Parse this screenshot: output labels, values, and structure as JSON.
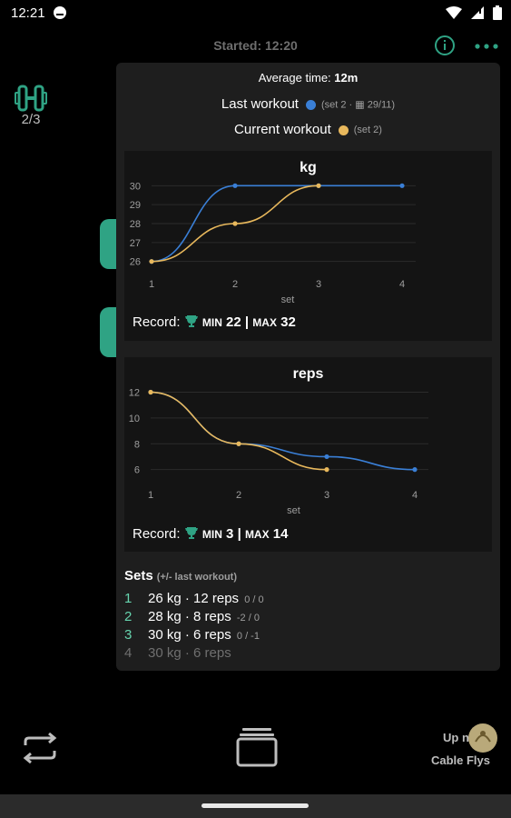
{
  "status": {
    "time": "12:21"
  },
  "header": {
    "started": "Started: 12:20"
  },
  "exercise": {
    "count": "2/3"
  },
  "panel": {
    "avg_label": "Average time:",
    "avg_value": "12m",
    "legend": {
      "last_label": "Last workout",
      "last_sub": "(set 2 · ▦ 29/11)",
      "current_label": "Current workout",
      "current_sub": "(set 2)"
    },
    "colors": {
      "last": "#3a7fd6",
      "current": "#e8b85c",
      "accent": "#2fa384"
    }
  },
  "chart_data": [
    {
      "type": "line",
      "title": "kg",
      "xlabel": "set",
      "x_ticks": [
        "1",
        "2",
        "3",
        "4"
      ],
      "y_ticks": [
        "26",
        "27",
        "28",
        "29",
        "30"
      ],
      "ylim": [
        25.6,
        30.4
      ],
      "series": [
        {
          "name": "Last workout",
          "x": [
            1,
            2,
            3,
            4
          ],
          "values": [
            26,
            30,
            30,
            30
          ]
        },
        {
          "name": "Current workout",
          "x": [
            1,
            2,
            3
          ],
          "values": [
            26,
            28,
            30
          ]
        }
      ],
      "record": {
        "label": "Record:",
        "min_label": "MIN",
        "min": "22",
        "sep": "|",
        "max_label": "MAX",
        "max": "32"
      }
    },
    {
      "type": "line",
      "title": "reps",
      "xlabel": "set",
      "x_ticks": [
        "1",
        "2",
        "3",
        "4"
      ],
      "y_ticks": [
        "6",
        "8",
        "10",
        "12"
      ],
      "ylim": [
        5.2,
        12.6
      ],
      "series": [
        {
          "name": "Last workout",
          "x": [
            1,
            2,
            3,
            4
          ],
          "values": [
            12,
            8,
            7,
            6
          ]
        },
        {
          "name": "Current workout",
          "x": [
            1,
            2,
            3
          ],
          "values": [
            12,
            8,
            6
          ]
        }
      ],
      "record": {
        "label": "Record:",
        "min_label": "MIN",
        "min": "3",
        "sep": "|",
        "max_label": "MAX",
        "max": "14"
      }
    }
  ],
  "sets": {
    "title": "Sets",
    "subtitle": "(+/- last workout)",
    "rows": [
      {
        "num": "1",
        "text": "26 kg · 12 reps",
        "diff": "0 / 0"
      },
      {
        "num": "2",
        "text": "28 kg · 8 reps",
        "diff": "-2 / 0"
      },
      {
        "num": "3",
        "text": "30 kg · 6 reps",
        "diff": "0 / -1"
      },
      {
        "num": "4",
        "text": "30 kg · 6 reps",
        "diff": ""
      }
    ]
  },
  "bottom": {
    "upnext_label": "Up next:",
    "upnext_name": "Cable Flys"
  },
  "icons": [
    "wifi-icon",
    "battery-icon",
    "info-icon",
    "more-icon",
    "exercise-icon",
    "swap-icon",
    "stack-icon",
    "trophy-icon"
  ]
}
